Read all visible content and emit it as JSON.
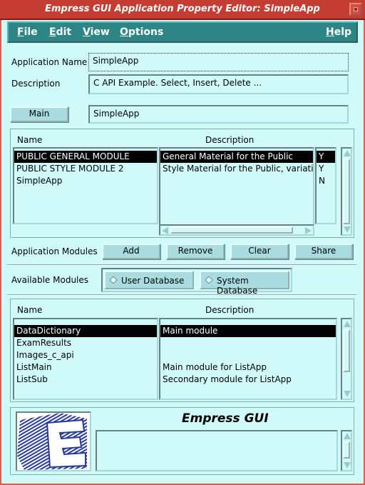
{
  "window": {
    "title": "Empress GUI Application Property Editor: SimpleApp"
  },
  "menu": {
    "file": "File",
    "edit": "Edit",
    "view": "View",
    "options": "Options",
    "help": "Help"
  },
  "form": {
    "app_name_label": "Application Name",
    "app_name_value": "SimpleApp",
    "description_label": "Description",
    "description_value": "C API Example. Select, Insert, Delete ...",
    "main_button": "Main",
    "main_value": "SimpleApp"
  },
  "app_modules": {
    "col_name": "Name",
    "col_description": "Description",
    "rows": [
      {
        "name": "PUBLIC GENERAL MODULE",
        "description": "General Material for the Public",
        "flag": "Y",
        "selected": true
      },
      {
        "name": "PUBLIC STYLE MODULE 2",
        "description": "Style Material for the Public, variatio",
        "flag": "Y",
        "selected": false
      },
      {
        "name": "SimpleApp",
        "description": "",
        "flag": "N",
        "selected": false
      }
    ],
    "label": "Application Modules",
    "add": "Add",
    "remove": "Remove",
    "clear": "Clear",
    "share": "Share"
  },
  "available": {
    "label": "Available Modules",
    "user_db": "User Database",
    "system_db": "System Database",
    "col_name": "Name",
    "col_description": "Description",
    "rows": [
      {
        "name": "DataDictionary",
        "description": "Main module",
        "selected": true
      },
      {
        "name": "ExamResults",
        "description": "",
        "selected": false
      },
      {
        "name": "Images_c_api",
        "description": "",
        "selected": false
      },
      {
        "name": "ListMain",
        "description": "Main module for ListApp",
        "selected": false
      },
      {
        "name": "ListSub",
        "description": "Secondary module for ListApp",
        "selected": false
      }
    ]
  },
  "footer": {
    "brand": "Empress GUI"
  },
  "colors": {
    "background": "#d0fafa",
    "titlebar": "#c43c32",
    "menubar": "#2e8585",
    "button": "#a9dce0"
  },
  "icons": {
    "logo": "empress-e-logo"
  }
}
